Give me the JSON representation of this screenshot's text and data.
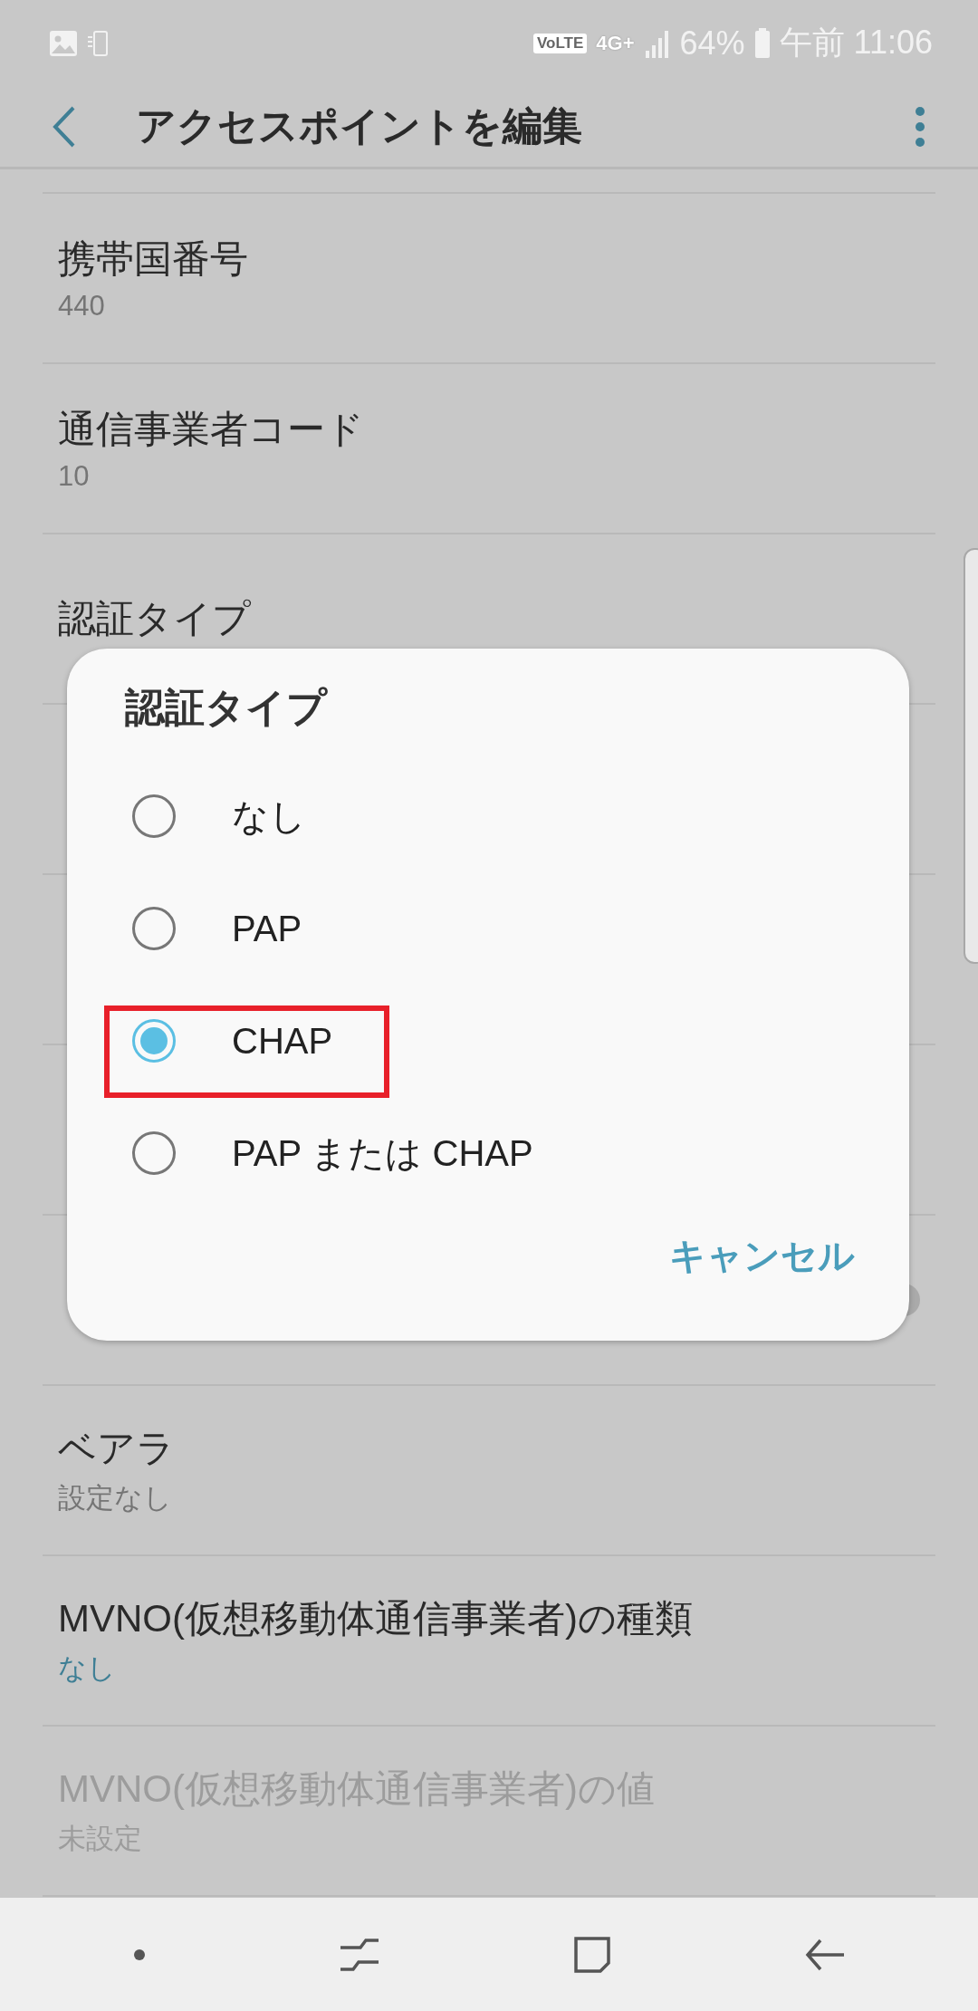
{
  "status_bar": {
    "volte": "VoLTE",
    "network": "4G+",
    "battery": "64%",
    "time": "午前 11:06"
  },
  "app_bar": {
    "title": "アクセスポイントを編集"
  },
  "settings": [
    {
      "kind": "text",
      "title": "携帯国番号",
      "value": "440",
      "accent": false,
      "disabled": false
    },
    {
      "kind": "text",
      "title": "通信事業者コード",
      "value": "10",
      "accent": false,
      "disabled": false
    },
    {
      "kind": "text",
      "title": "認証タイプ",
      "disabled": false
    },
    {
      "kind": "covered"
    },
    {
      "kind": "covered"
    },
    {
      "kind": "covered"
    },
    {
      "kind": "covered",
      "toggle": {
        "on": false
      }
    },
    {
      "kind": "text",
      "title": "ベアラ",
      "value": "設定なし",
      "accent": false,
      "disabled": false
    },
    {
      "kind": "text",
      "title": "MVNO(仮想移動体通信事業者)の種類",
      "value": "なし",
      "accent": true,
      "disabled": false
    },
    {
      "kind": "text",
      "title": "MVNO(仮想移動体通信事業者)の値",
      "value": "未設定",
      "accent": false,
      "disabled": true
    }
  ],
  "dialog": {
    "title": "認証タイプ",
    "options": [
      {
        "label": "なし",
        "selected": false,
        "outlined": false
      },
      {
        "label": "PAP",
        "selected": false,
        "outlined": false
      },
      {
        "label": "CHAP",
        "selected": true,
        "outlined": true
      },
      {
        "label": "PAP または CHAP",
        "selected": false,
        "outlined": false
      }
    ],
    "cancel": "キャンセル"
  }
}
